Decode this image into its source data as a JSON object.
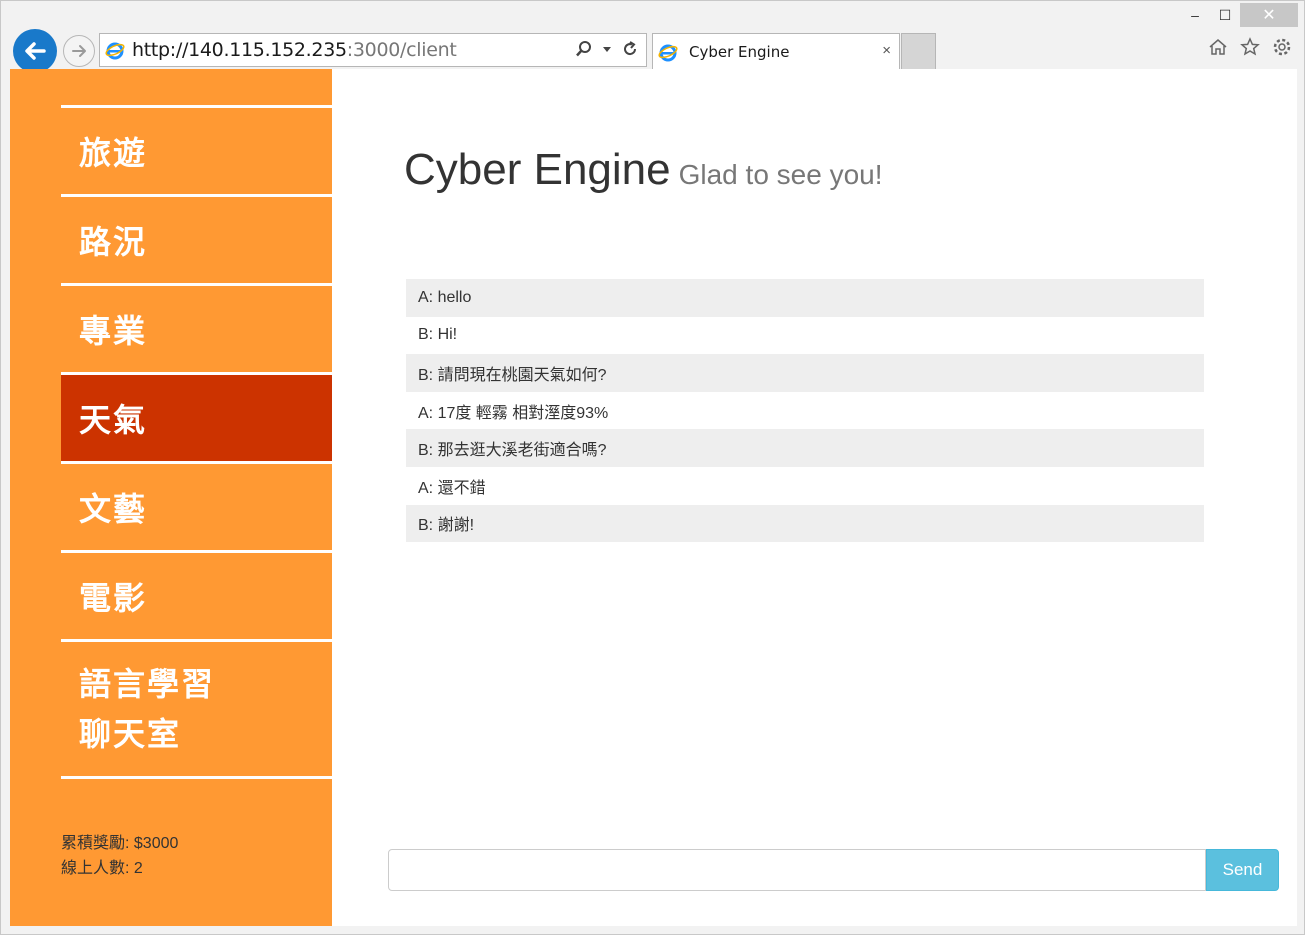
{
  "browser": {
    "url_host": "http://140.115.152.235",
    "url_rest": ":3000/client",
    "tab_title": "Cyber Engine",
    "tab_close": "×",
    "window_controls": {
      "minimize": "‒",
      "maximize": "☐",
      "close": "✕"
    }
  },
  "sidebar": {
    "items": [
      {
        "label": "旅遊"
      },
      {
        "label": "路況"
      },
      {
        "label": "專業"
      },
      {
        "label": "天氣",
        "active": true
      },
      {
        "label": "文藝"
      },
      {
        "label": "電影"
      },
      {
        "label_line1": "語言學習",
        "label_line2": "聊天室"
      }
    ],
    "reward_text": "累積獎勵: $3000",
    "online_text": "線上人數: 2"
  },
  "header": {
    "title": "Cyber Engine",
    "subtitle": "Glad to see you!"
  },
  "chat": {
    "messages": [
      "A: hello",
      "B: Hi!",
      "B: 請問現在桃園天氣如何?",
      "A: 17度 輕霧 相對溼度93%",
      "B: 那去逛大溪老街適合嗎?",
      "A: 還不錯",
      "B: 謝謝!"
    ]
  },
  "composer": {
    "input_value": "",
    "send_label": "Send"
  },
  "colors": {
    "sidebar_bg": "#ff9933",
    "active_item": "#cc3300",
    "send_button": "#5bc0de",
    "back_button": "#1979ca"
  }
}
